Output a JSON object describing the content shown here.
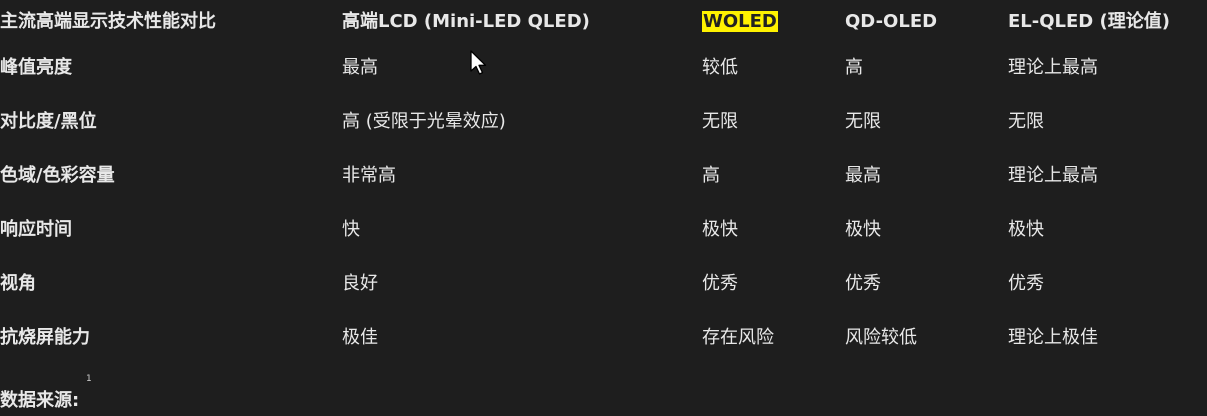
{
  "header": {
    "c0": "主流高端显示技术性能对比",
    "c1": "高端LCD (Mini-LED QLED)",
    "c2": "WOLED",
    "c3": "QD-OLED",
    "c4": "EL-QLED (理论值)"
  },
  "rows": [
    {
      "c0": "峰值亮度",
      "c1": "最高",
      "c2": "较低",
      "c3": "高",
      "c4": "理论上最高"
    },
    {
      "c0": "对比度/黑位",
      "c1": "高 (受限于光晕效应)",
      "c2": "无限",
      "c3": "无限",
      "c4": "无限"
    },
    {
      "c0": "色域/色彩容量",
      "c1": "非常高",
      "c2": "高",
      "c3": "最高",
      "c4": "理论上最高"
    },
    {
      "c0": "响应时间",
      "c1": "快",
      "c2": "极快",
      "c3": "极快",
      "c4": "极快"
    },
    {
      "c0": "视角",
      "c1": "良好",
      "c2": "优秀",
      "c3": "优秀",
      "c4": "优秀"
    },
    {
      "c0": "抗烧屏能力",
      "c1": "极佳",
      "c2": "存在风险",
      "c3": "风险较低",
      "c4": "理论上极佳"
    }
  ],
  "footer": {
    "label": "数据来源:",
    "citation": "1"
  },
  "colors": {
    "background": "#1e1e1e",
    "text": "#e8e8e8",
    "highlight": "#fff200"
  },
  "icons": {
    "cursor": "mouse-pointer-icon"
  }
}
